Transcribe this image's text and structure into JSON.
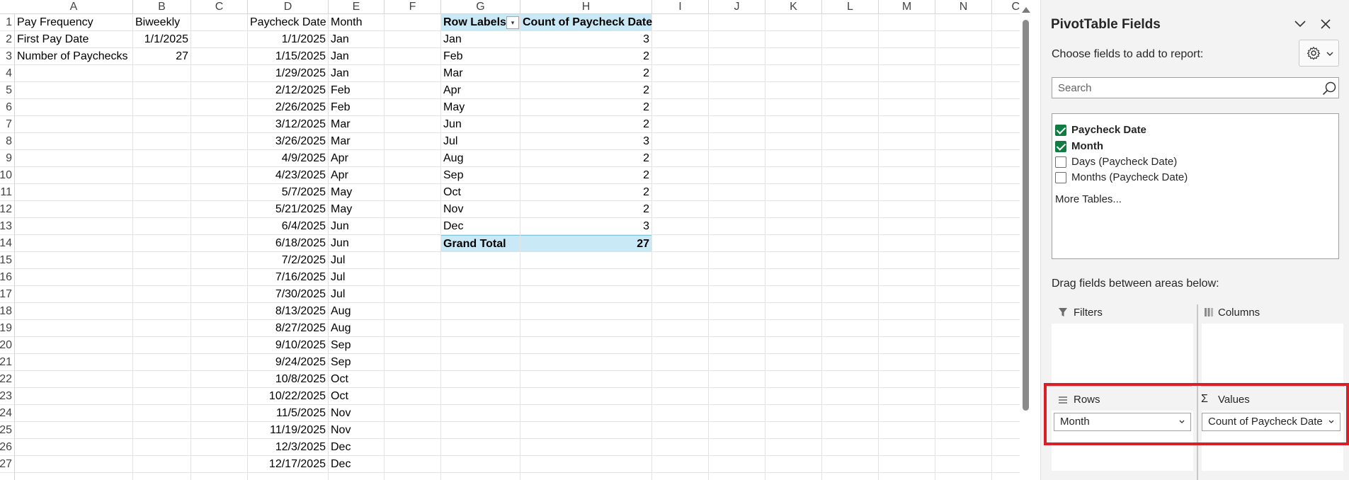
{
  "sheet": {
    "columns": [
      "A",
      "B",
      "C",
      "D",
      "E",
      "F",
      "G",
      "H",
      "I",
      "J",
      "K",
      "L",
      "M",
      "N",
      "C"
    ],
    "row_numbers": [
      "1",
      "2",
      "3",
      "4",
      "5",
      "6",
      "7",
      "8",
      "9",
      "10",
      "11",
      "12",
      "13",
      "14",
      "15",
      "16",
      "17",
      "18",
      "19",
      "20",
      "21",
      "22",
      "23",
      "24",
      "25",
      "26",
      "27"
    ],
    "settings": {
      "pay_frequency_label": "Pay Frequency",
      "pay_frequency_value": "Biweekly",
      "first_pay_date_label": "First Pay Date",
      "first_pay_date_value": "1/1/2025",
      "number_of_paychecks_label": "Number of Paychecks",
      "number_of_paychecks_value": "27"
    },
    "table_headers": {
      "paycheck_date": "Paycheck Date",
      "month": "Month"
    },
    "paychecks": [
      [
        "1/1/2025",
        "Jan"
      ],
      [
        "1/15/2025",
        "Jan"
      ],
      [
        "1/29/2025",
        "Jan"
      ],
      [
        "2/12/2025",
        "Feb"
      ],
      [
        "2/26/2025",
        "Feb"
      ],
      [
        "3/12/2025",
        "Mar"
      ],
      [
        "3/26/2025",
        "Mar"
      ],
      [
        "4/9/2025",
        "Apr"
      ],
      [
        "4/23/2025",
        "Apr"
      ],
      [
        "5/7/2025",
        "May"
      ],
      [
        "5/21/2025",
        "May"
      ],
      [
        "6/4/2025",
        "Jun"
      ],
      [
        "6/18/2025",
        "Jun"
      ],
      [
        "7/2/2025",
        "Jul"
      ],
      [
        "7/16/2025",
        "Jul"
      ],
      [
        "7/30/2025",
        "Jul"
      ],
      [
        "8/13/2025",
        "Aug"
      ],
      [
        "8/27/2025",
        "Aug"
      ],
      [
        "9/10/2025",
        "Sep"
      ],
      [
        "9/24/2025",
        "Sep"
      ],
      [
        "10/8/2025",
        "Oct"
      ],
      [
        "10/22/2025",
        "Oct"
      ],
      [
        "11/5/2025",
        "Nov"
      ],
      [
        "11/19/2025",
        "Nov"
      ],
      [
        "12/3/2025",
        "Dec"
      ],
      [
        "12/17/2025",
        "Dec"
      ]
    ],
    "pivot": {
      "header_row_labels": "Row Labels",
      "header_count": "Count of Paycheck Date",
      "rows": [
        [
          "Jan",
          "3"
        ],
        [
          "Feb",
          "2"
        ],
        [
          "Mar",
          "2"
        ],
        [
          "Apr",
          "2"
        ],
        [
          "May",
          "2"
        ],
        [
          "Jun",
          "2"
        ],
        [
          "Jul",
          "3"
        ],
        [
          "Aug",
          "2"
        ],
        [
          "Sep",
          "2"
        ],
        [
          "Oct",
          "2"
        ],
        [
          "Nov",
          "2"
        ],
        [
          "Dec",
          "3"
        ]
      ],
      "total_label": "Grand Total",
      "total_value": "27"
    }
  },
  "pane": {
    "title": "PivotTable Fields",
    "subtitle": "Choose fields to add to report:",
    "search_placeholder": "Search",
    "fields": [
      {
        "label": "Paycheck Date",
        "checked": true
      },
      {
        "label": "Month",
        "checked": true
      },
      {
        "label": "Days (Paycheck Date)",
        "checked": false
      },
      {
        "label": "Months (Paycheck Date)",
        "checked": false
      }
    ],
    "more_tables": "More Tables...",
    "drag_hint": "Drag fields between areas below:",
    "areas": {
      "filters": "Filters",
      "columns": "Columns",
      "rows": "Rows",
      "values": "Values"
    },
    "rows_field": "Month",
    "values_field": "Count of Paycheck Date",
    "icons": {
      "collapse": "chevron-down-icon",
      "close": "close-icon",
      "settings": "gear-icon",
      "search": "search-icon",
      "filters": "filter-icon",
      "columns": "columns-icon",
      "rows": "rows-icon",
      "values": "sigma-icon"
    },
    "accent_color": "#107c41",
    "highlight_color": "#d8202a"
  }
}
